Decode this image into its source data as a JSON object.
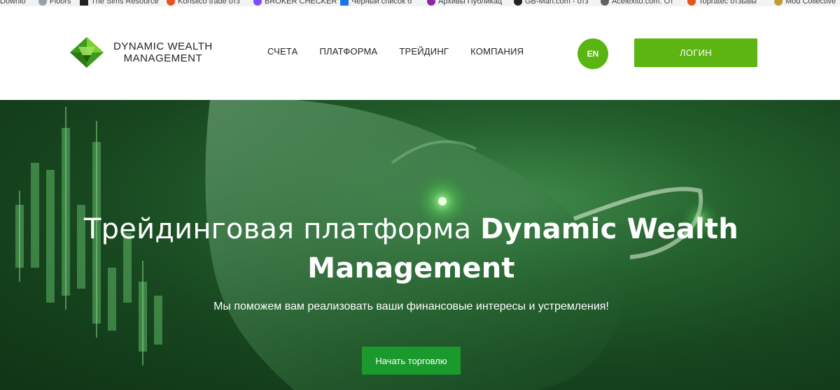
{
  "bookmarks": [
    {
      "label": "Downlo",
      "color": "#9aa0a6"
    },
    {
      "label": "Floors",
      "color": "#9aa0a6"
    },
    {
      "label": "The Sims Resource",
      "color": "#222222"
    },
    {
      "label": "Konsilco trade отз",
      "color": "#e8541c"
    },
    {
      "label": "BROKER CHECKER",
      "color": "#7c4dff"
    },
    {
      "label": "Черный список б",
      "color": "#1a73e8"
    },
    {
      "label": "Архивы Публикац",
      "color": "#8e24aa"
    },
    {
      "label": "GB-Man.com - отз",
      "color": "#222222"
    },
    {
      "label": "Acelexito.com: От",
      "color": "#5f6368"
    },
    {
      "label": "Topratec отзывы",
      "color": "#e8541c"
    },
    {
      "label": "Mod Collective",
      "color": "#c49a35"
    }
  ],
  "header": {
    "logo_line1": "DYNAMIC WEALTH",
    "logo_line2": "MANAGEMENT",
    "nav": [
      "СЧЕТА",
      "ПЛАТФОРМА",
      "ТРЕЙДИНГ",
      "КОМПАНИЯ"
    ],
    "lang": "EN",
    "login": "ЛОГИН"
  },
  "hero": {
    "title_part1": "Трейдинговая платформа ",
    "title_part2": "Dynamic Wealth Management",
    "subtitle": "Мы поможем вам реализовать ваши финансовые интересы и устремления!",
    "cta": "Начать торговлю"
  },
  "colors": {
    "accent": "#5cb513",
    "cta": "#1a9a2c",
    "hero_dark": "#17461f"
  },
  "icons": {
    "logo": "diamond-logo-icon"
  }
}
